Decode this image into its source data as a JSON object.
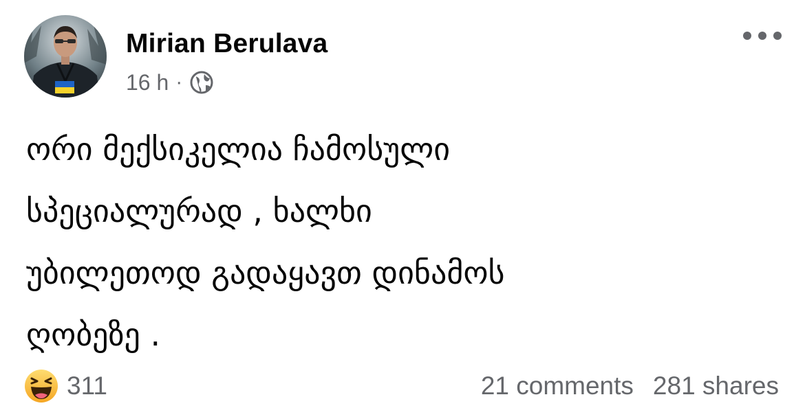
{
  "post": {
    "author": "Mirian Berulava",
    "timestamp": "16 h",
    "separator": "·",
    "privacy_icon": "globe-icon",
    "more_icon": "more-options-icon",
    "text_lines": [
      "ორი მექსიკელია ჩამოსული",
      "სპეციალურად , ხალხი",
      "უბილეთოდ გადაყავთ დინამოს",
      "ღობეზე ."
    ]
  },
  "footer": {
    "reaction_icon": "haha-reaction-icon",
    "reaction_count": "311",
    "comments": "21 comments",
    "shares": "281 shares"
  },
  "colors": {
    "text": "#050505",
    "secondary": "#65676b",
    "reaction_yellow": "#f7b125"
  }
}
